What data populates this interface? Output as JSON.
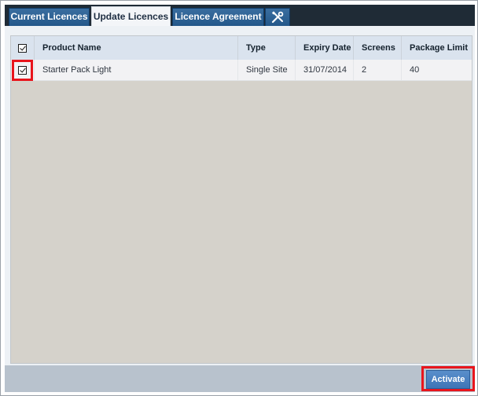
{
  "tabs": [
    {
      "label": "Current Licences",
      "active": false
    },
    {
      "label": "Update Licences",
      "active": true
    },
    {
      "label": "Licence Agreement",
      "active": false
    },
    {
      "label": "",
      "icon": "tools-icon",
      "active": false
    }
  ],
  "table": {
    "columns": [
      "Product Name",
      "Type",
      "Expiry Date",
      "Screens",
      "Package Limit"
    ],
    "header_checked": true,
    "rows": [
      {
        "checked": true,
        "cells": [
          "Starter Pack Light",
          "Single Site",
          "31/07/2014",
          "2",
          "40"
        ]
      }
    ]
  },
  "footer": {
    "activate_label": "Activate"
  },
  "colors": {
    "tab_bar": "#1f2b36",
    "tab_bg": "#2d6398",
    "highlight": "#e8151c",
    "grid_empty": "#d5d2cb",
    "button": "#4a80c0"
  }
}
